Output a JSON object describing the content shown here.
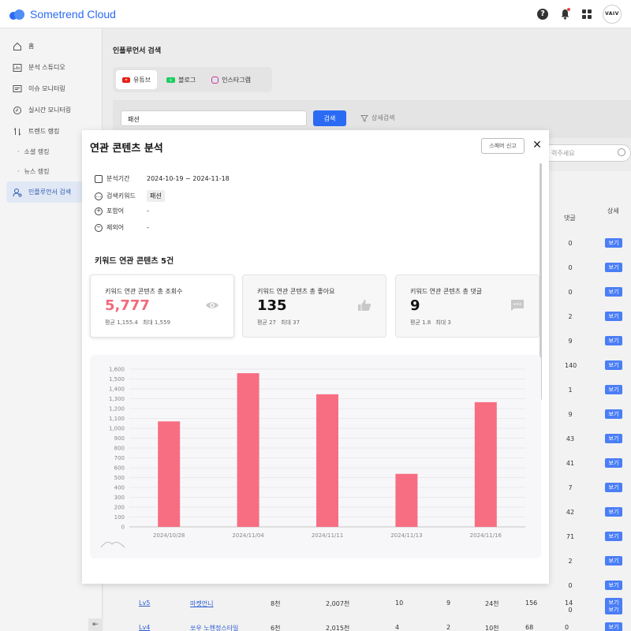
{
  "header": {
    "brand": "Sometrend Cloud",
    "help_glyph": "?",
    "profile_label": "VAIV"
  },
  "sidebar": {
    "items": [
      {
        "label": "홈",
        "icon": "home-icon"
      },
      {
        "label": "분석 스튜디오",
        "icon": "studio-icon"
      },
      {
        "label": "이슈 모니터링",
        "icon": "monitor-icon"
      },
      {
        "label": "실시간 모니터링",
        "icon": "clock-icon"
      },
      {
        "label": "트렌드 랭킹",
        "icon": "sort-icon"
      }
    ],
    "sub_items": [
      {
        "label": "소셜 랭킹"
      },
      {
        "label": "뉴스 랭킹"
      }
    ],
    "active_item": {
      "label": "인플루언서 검색",
      "icon": "influencer-icon"
    },
    "collapse_label": "⇤"
  },
  "main": {
    "title": "인플루언서 검색",
    "platform_tabs": [
      {
        "label": "유튜브",
        "active": true
      },
      {
        "label": "블로그",
        "active": false
      },
      {
        "label": "인스타그램",
        "active": false
      }
    ],
    "search": {
      "value": "패션",
      "button_label": "검색",
      "advanced_label": "상세검색",
      "filter_placeholder": "력주세요"
    },
    "table": {
      "headers": [
        "댓글",
        "상세"
      ],
      "comment_values": [
        "0",
        "0",
        "0",
        "2",
        "9",
        "140",
        "1",
        "9",
        "43",
        "41",
        "7",
        "42",
        "71",
        "2",
        "0",
        "0"
      ],
      "view_label": "보기",
      "bottom_rows": [
        {
          "level": "Lv5",
          "name": "마켓언니",
          "subs": "8천",
          "views": "2,007천",
          "c1": "10",
          "c2": "9",
          "c3": "24천",
          "c4": "156",
          "comments": "14"
        },
        {
          "level": "Lv4",
          "name": "쏘우 노헨정스타일",
          "subs": "6천",
          "views": "2,015천",
          "c1": "4",
          "c2": "2",
          "c3": "10천",
          "c4": "68",
          "comments": "0"
        }
      ]
    }
  },
  "modal": {
    "title": "연관 콘텐츠 분석",
    "report_label": "스패머 신고",
    "close_glyph": "✕",
    "meta": {
      "period_label": "분석기간",
      "period_value": "2024-10-19 ~ 2024-11-18",
      "keyword_label": "검색키워드",
      "keyword_value": "패션",
      "include_label": "포함어",
      "include_value": "-",
      "exclude_label": "제외어",
      "exclude_value": "-"
    },
    "section_title": "키워드 연관 콘텐츠  5건",
    "stats": [
      {
        "label": "키워드 연관 콘텐츠 총 조회수",
        "value": "5,777",
        "avg": "평균 1,155.4",
        "max": "최대 1,559",
        "icon": "eye-icon"
      },
      {
        "label": "키워드 연관 콘텐츠 총 좋아요",
        "value": "135",
        "avg": "평균 27",
        "max": "최대 37",
        "icon": "thumbs-up-icon"
      },
      {
        "label": "키워드 연관 콘텐츠 총 댓글",
        "value": "9",
        "avg": "평균 1.8",
        "max": "최대 3",
        "icon": "comment-icon"
      }
    ]
  },
  "chart_data": {
    "type": "bar",
    "categories": [
      "2024/10/28",
      "2024/11/04",
      "2024/11/11",
      "2024/11/13",
      "2024/11/16"
    ],
    "values": [
      1070,
      1559,
      1345,
      538,
      1265
    ],
    "yticks": [
      "0",
      "100",
      "200",
      "300",
      "400",
      "500",
      "600",
      "700",
      "800",
      "900",
      "1,000",
      "1,100",
      "1,200",
      "1,300",
      "1,400",
      "1,500",
      "1,600"
    ],
    "ylim": [
      0,
      1600
    ],
    "bar_color": "#f76e82",
    "grid": true
  }
}
